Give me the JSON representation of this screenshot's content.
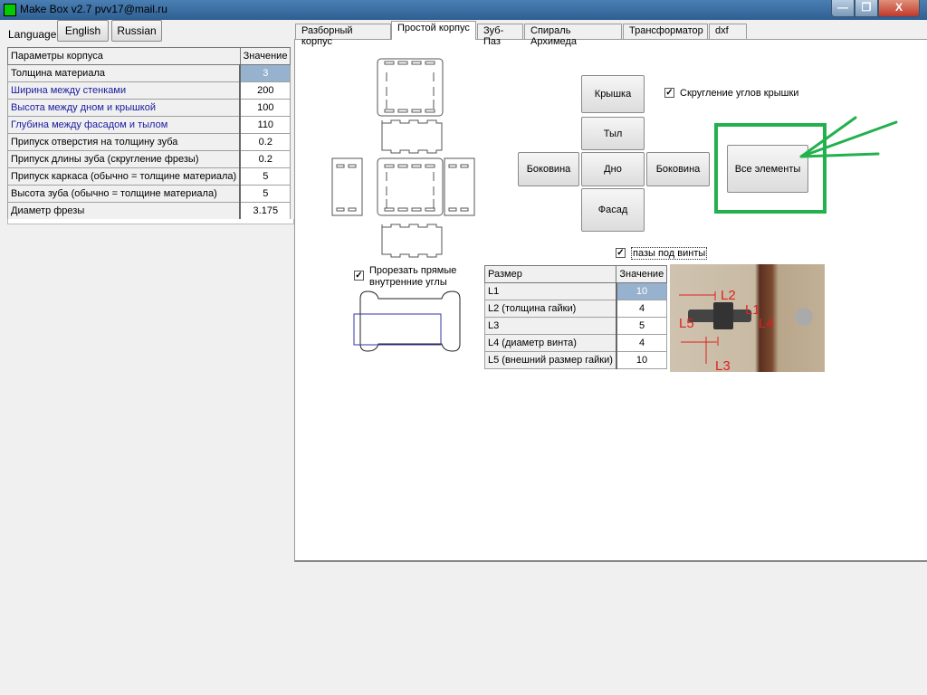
{
  "window": {
    "title": "Make Box v2.7  pvv17@mail.ru",
    "minimize": "—",
    "restore": "❐",
    "close": "X"
  },
  "language": {
    "label": "Language",
    "english": "English",
    "russian": "Russian"
  },
  "params": {
    "headers": [
      "Параметры корпуса",
      "Значение"
    ],
    "rows": [
      {
        "name": "Толщина материала",
        "value": "3",
        "selected": true
      },
      {
        "name": "Ширина между стенками",
        "value": "200",
        "blue": true
      },
      {
        "name": "Высота между дном и крышкой",
        "value": "100",
        "blue": true
      },
      {
        "name": "Глубина между фасадом и тылом",
        "value": "110",
        "blue": true
      },
      {
        "name": "Припуск отверстия на толщину зуба",
        "value": "0.2"
      },
      {
        "name": "Припуск длины зуба (скругление фрезы)",
        "value": "0.2"
      },
      {
        "name": "Припуск каркаса (обычно = толщине материала)",
        "value": "5"
      },
      {
        "name": "Высота зуба (обычно = толщине материала)",
        "value": "5"
      },
      {
        "name": "Диаметр фрезы",
        "value": "3.175"
      }
    ]
  },
  "tabs": [
    "Разборный корпус",
    "Простой корпус",
    "Зуб-Паз",
    "Спираль Архимеда",
    "Трансформатор",
    "dxf"
  ],
  "active_tab": "Простой корпус",
  "parts": {
    "lid": "Крышка",
    "back": "Тыл",
    "side_left": "Боковина",
    "bottom": "Дно",
    "side_right": "Боковина",
    "front": "Фасад",
    "all": "Все элементы"
  },
  "options": {
    "round_lid": "Скругление углов крышки",
    "round_lid_checked": true,
    "screw_slots": "пазы под винты",
    "screw_slots_checked": true,
    "cut_corners_1": "Прорезать прямые",
    "cut_corners_2": "внутренние углы",
    "cut_corners_checked": true
  },
  "screw": {
    "headers": [
      "Размер",
      "Значение"
    ],
    "rows": [
      {
        "name": "L1",
        "value": "10",
        "selected": true
      },
      {
        "name": "L2 (толщина гайки)",
        "value": "4"
      },
      {
        "name": "L3",
        "value": "5"
      },
      {
        "name": "L4 (диаметр винта)",
        "value": "4"
      },
      {
        "name": "L5 (внешний размер гайки)",
        "value": "10"
      }
    ]
  },
  "photo_labels": [
    "L1",
    "L2",
    "L3",
    "L4",
    "L5"
  ],
  "colors": {
    "annotation": "#22b14c",
    "selection": "#97b2cf",
    "photo_label": "#e02020"
  }
}
